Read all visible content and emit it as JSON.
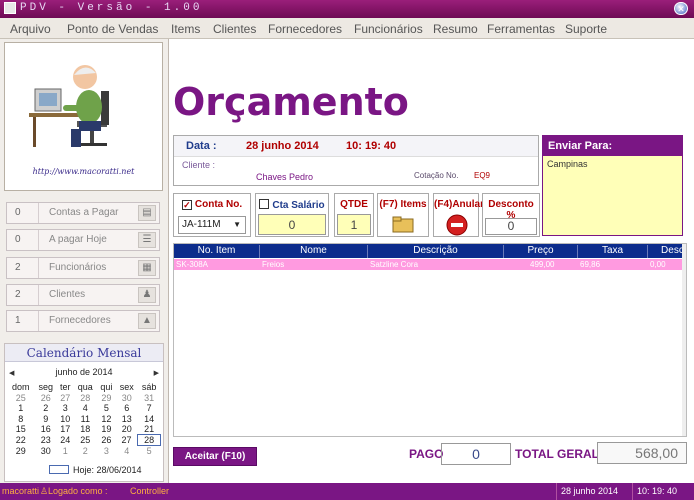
{
  "window": {
    "title": "PDV - Versão - 1.00",
    "close_glyph": "✕"
  },
  "menu": [
    "Arquivo",
    "Ponto de Vendas",
    "Items",
    "Clientes",
    "Fornecedores",
    "Funcionários",
    "Resumo",
    "Ferramentas",
    "Suporte"
  ],
  "sidebar": {
    "logo_url": "http://www.macoratti.net",
    "stats": [
      {
        "count": "0",
        "label": "Contas a Pagar",
        "icon": "clipboard-icon"
      },
      {
        "count": "0",
        "label": "A pagar Hoje",
        "icon": "list-icon"
      },
      {
        "count": "2",
        "label": "Funcionários",
        "icon": "id-card-icon"
      },
      {
        "count": "2",
        "label": "Clientes",
        "icon": "people-icon"
      },
      {
        "count": "1",
        "label": "Fornecedores",
        "icon": "truck-icon"
      }
    ]
  },
  "calendar": {
    "title": "Calendário Mensal",
    "month_label": "junho de 2014",
    "prev": "◀",
    "next": "▶",
    "weekdays": [
      "dom",
      "seg",
      "ter",
      "qua",
      "qui",
      "sex",
      "sáb"
    ],
    "weeks": [
      [
        "25",
        "26",
        "27",
        "28",
        "29",
        "30",
        "31"
      ],
      [
        "1",
        "2",
        "3",
        "4",
        "5",
        "6",
        "7"
      ],
      [
        "8",
        "9",
        "10",
        "11",
        "12",
        "13",
        "14"
      ],
      [
        "15",
        "16",
        "17",
        "18",
        "19",
        "20",
        "21"
      ],
      [
        "22",
        "23",
        "24",
        "25",
        "26",
        "27",
        "28"
      ],
      [
        "29",
        "30",
        "1",
        "2",
        "3",
        "4",
        "5"
      ]
    ],
    "today_label": "Hoje: 28/06/2014"
  },
  "main": {
    "heading": "Orçamento",
    "data_label": "Data :",
    "date": "28  junho  2014",
    "time": "10: 19: 40",
    "cliente_label": "Cliente :",
    "cliente_value": "Chaves Pedro",
    "cotacao_label": "Cotação No.",
    "cotacao_value": "EQ9",
    "enviar_title": "Enviar Para:",
    "enviar_value": "Campinas",
    "conta_label": "Conta No.",
    "conta_value": "JA-111M",
    "cta_salario_label": "Cta Salário",
    "cta_salario_value": "0",
    "qtde_label": "QTDE",
    "qtde_value": "1",
    "items_label": "(F7) Items",
    "anular_label": "(F4)Anular",
    "desconto_label": "Desconto %",
    "desconto_value": "0",
    "columns": [
      "No. Item",
      "Nome",
      "Descrição",
      "Preço",
      "Taxa",
      "Descon"
    ],
    "rows": [
      [
        "SK-308A",
        "Freios",
        "Satzline Cora",
        "499,00",
        "69,86",
        "0,00"
      ]
    ],
    "aceitar_label": "Aceitar (F10)",
    "pago_label": "PAGO",
    "pago_value": "0",
    "total_label": "TOTAL GERAL",
    "total_value": "568,00"
  },
  "status": {
    "user": "macoratti",
    "logado_label": "Logado como :",
    "role": "Controller",
    "date": "28  junho  2014",
    "time": "10: 19: 40"
  },
  "colors": {
    "accent": "#7a1684",
    "header_blue": "#0c2c8c",
    "row_pink": "#ff9ae0",
    "input_yellow": "#ffffb8"
  }
}
